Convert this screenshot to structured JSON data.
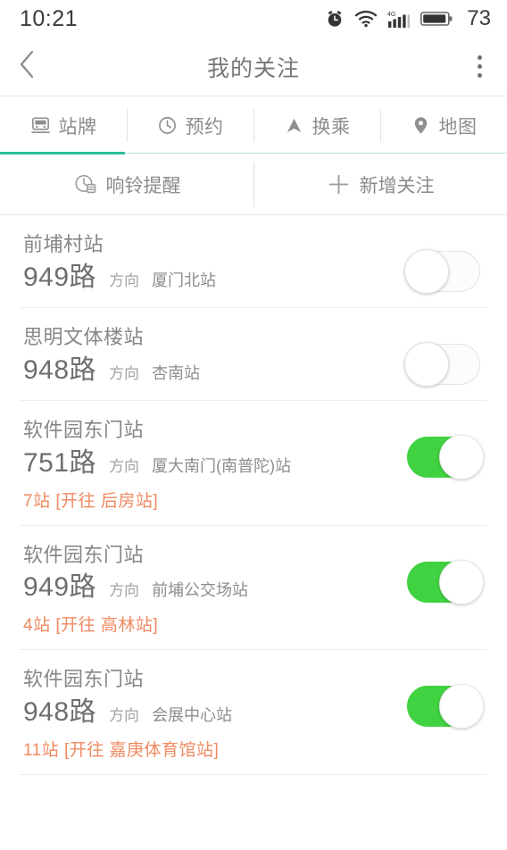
{
  "status_bar": {
    "time": "10:21",
    "battery_level": "73",
    "icons": [
      "alarm-clock-icon",
      "wifi-icon",
      "signal-4g-icon",
      "battery-icon"
    ]
  },
  "title_bar": {
    "back_icon": "chevron-left-icon",
    "title": "我的关注",
    "more_icon": "more-vertical-icon"
  },
  "tabs": [
    {
      "label": "站牌",
      "icon": "bus-sign-icon",
      "active": true
    },
    {
      "label": "预约",
      "icon": "clock-icon",
      "active": false
    },
    {
      "label": "换乘",
      "icon": "transfer-arrow-icon",
      "active": false
    },
    {
      "label": "地图",
      "icon": "map-pin-icon",
      "active": false
    }
  ],
  "actions": [
    {
      "label": "响铃提醒",
      "icon": "alarm-reminder-icon"
    },
    {
      "label": "新增关注",
      "icon": "plus-icon"
    }
  ],
  "colors": {
    "accent_green": "#2bbf9a",
    "toggle_on": "#41d241",
    "eta_orange": "#f08a63",
    "text_gray": "#868686"
  },
  "favorites": [
    {
      "station": "前埔村站",
      "route": "949路",
      "direction_label": "方向",
      "destination": "厦门北站",
      "eta": "",
      "toggle_on": false
    },
    {
      "station": "思明文体楼站",
      "route": "948路",
      "direction_label": "方向",
      "destination": "杏南站",
      "eta": "",
      "toggle_on": false
    },
    {
      "station": "软件园东门站",
      "route": "751路",
      "direction_label": "方向",
      "destination": "厦大南门(南普陀)站",
      "eta": "7站 [开往 后房站]",
      "toggle_on": true
    },
    {
      "station": "软件园东门站",
      "route": "949路",
      "direction_label": "方向",
      "destination": "前埔公交场站",
      "eta": "4站 [开往 高林站]",
      "toggle_on": true
    },
    {
      "station": "软件园东门站",
      "route": "948路",
      "direction_label": "方向",
      "destination": "会展中心站",
      "eta": "11站 [开往 嘉庚体育馆站]",
      "toggle_on": true
    }
  ]
}
